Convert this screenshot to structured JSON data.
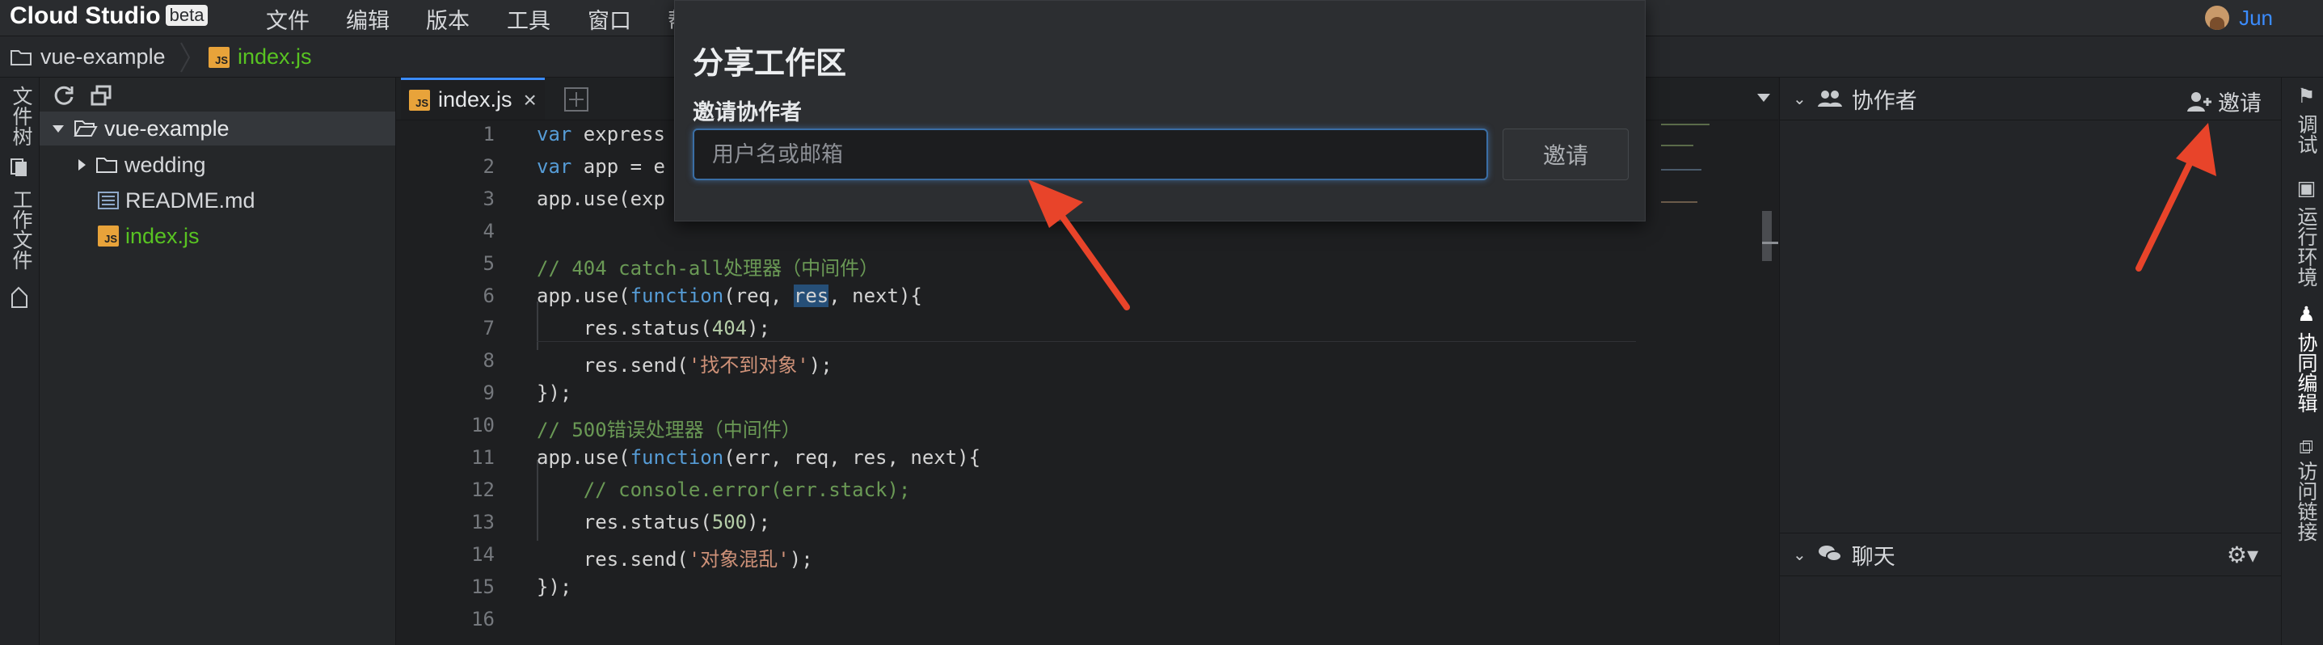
{
  "app": {
    "brand": "Cloud Studio",
    "badge": "beta"
  },
  "menu": [
    "文件",
    "编辑",
    "版本",
    "工具",
    "窗口",
    "帮"
  ],
  "user": {
    "name": "Jun"
  },
  "breadcrumb": {
    "project": "vue-example",
    "file": "index.js"
  },
  "left_strip": {
    "tab_files": "文件树",
    "tab_workspace": "工作文件"
  },
  "explorer": {
    "root": "vue-example",
    "items": [
      {
        "label": "wedding",
        "kind": "folder"
      },
      {
        "label": "README.md",
        "kind": "markdown"
      },
      {
        "label": "index.js",
        "kind": "js"
      }
    ]
  },
  "editor": {
    "tab_label": "index.js",
    "file_icon_text": "JS",
    "line_numbers": [
      "1",
      "2",
      "3",
      "4",
      "5",
      "6",
      "7",
      "8",
      "9",
      "10",
      "11",
      "12",
      "13",
      "14",
      "15",
      "16"
    ]
  },
  "modal": {
    "title": "分享工作区",
    "label": "邀请协作者",
    "placeholder": "用户名或邮箱",
    "button": "邀请"
  },
  "right_panel": {
    "collab_title": "协作者",
    "invite_label": "邀请",
    "chat_title": "聊天"
  },
  "right_strip": [
    "调试",
    "运行环境",
    "协同编辑",
    "访问链接"
  ],
  "colors": {
    "accent": "#3b8cff",
    "file_active": "#58c322",
    "annotation_arrow": "#e8442a"
  }
}
